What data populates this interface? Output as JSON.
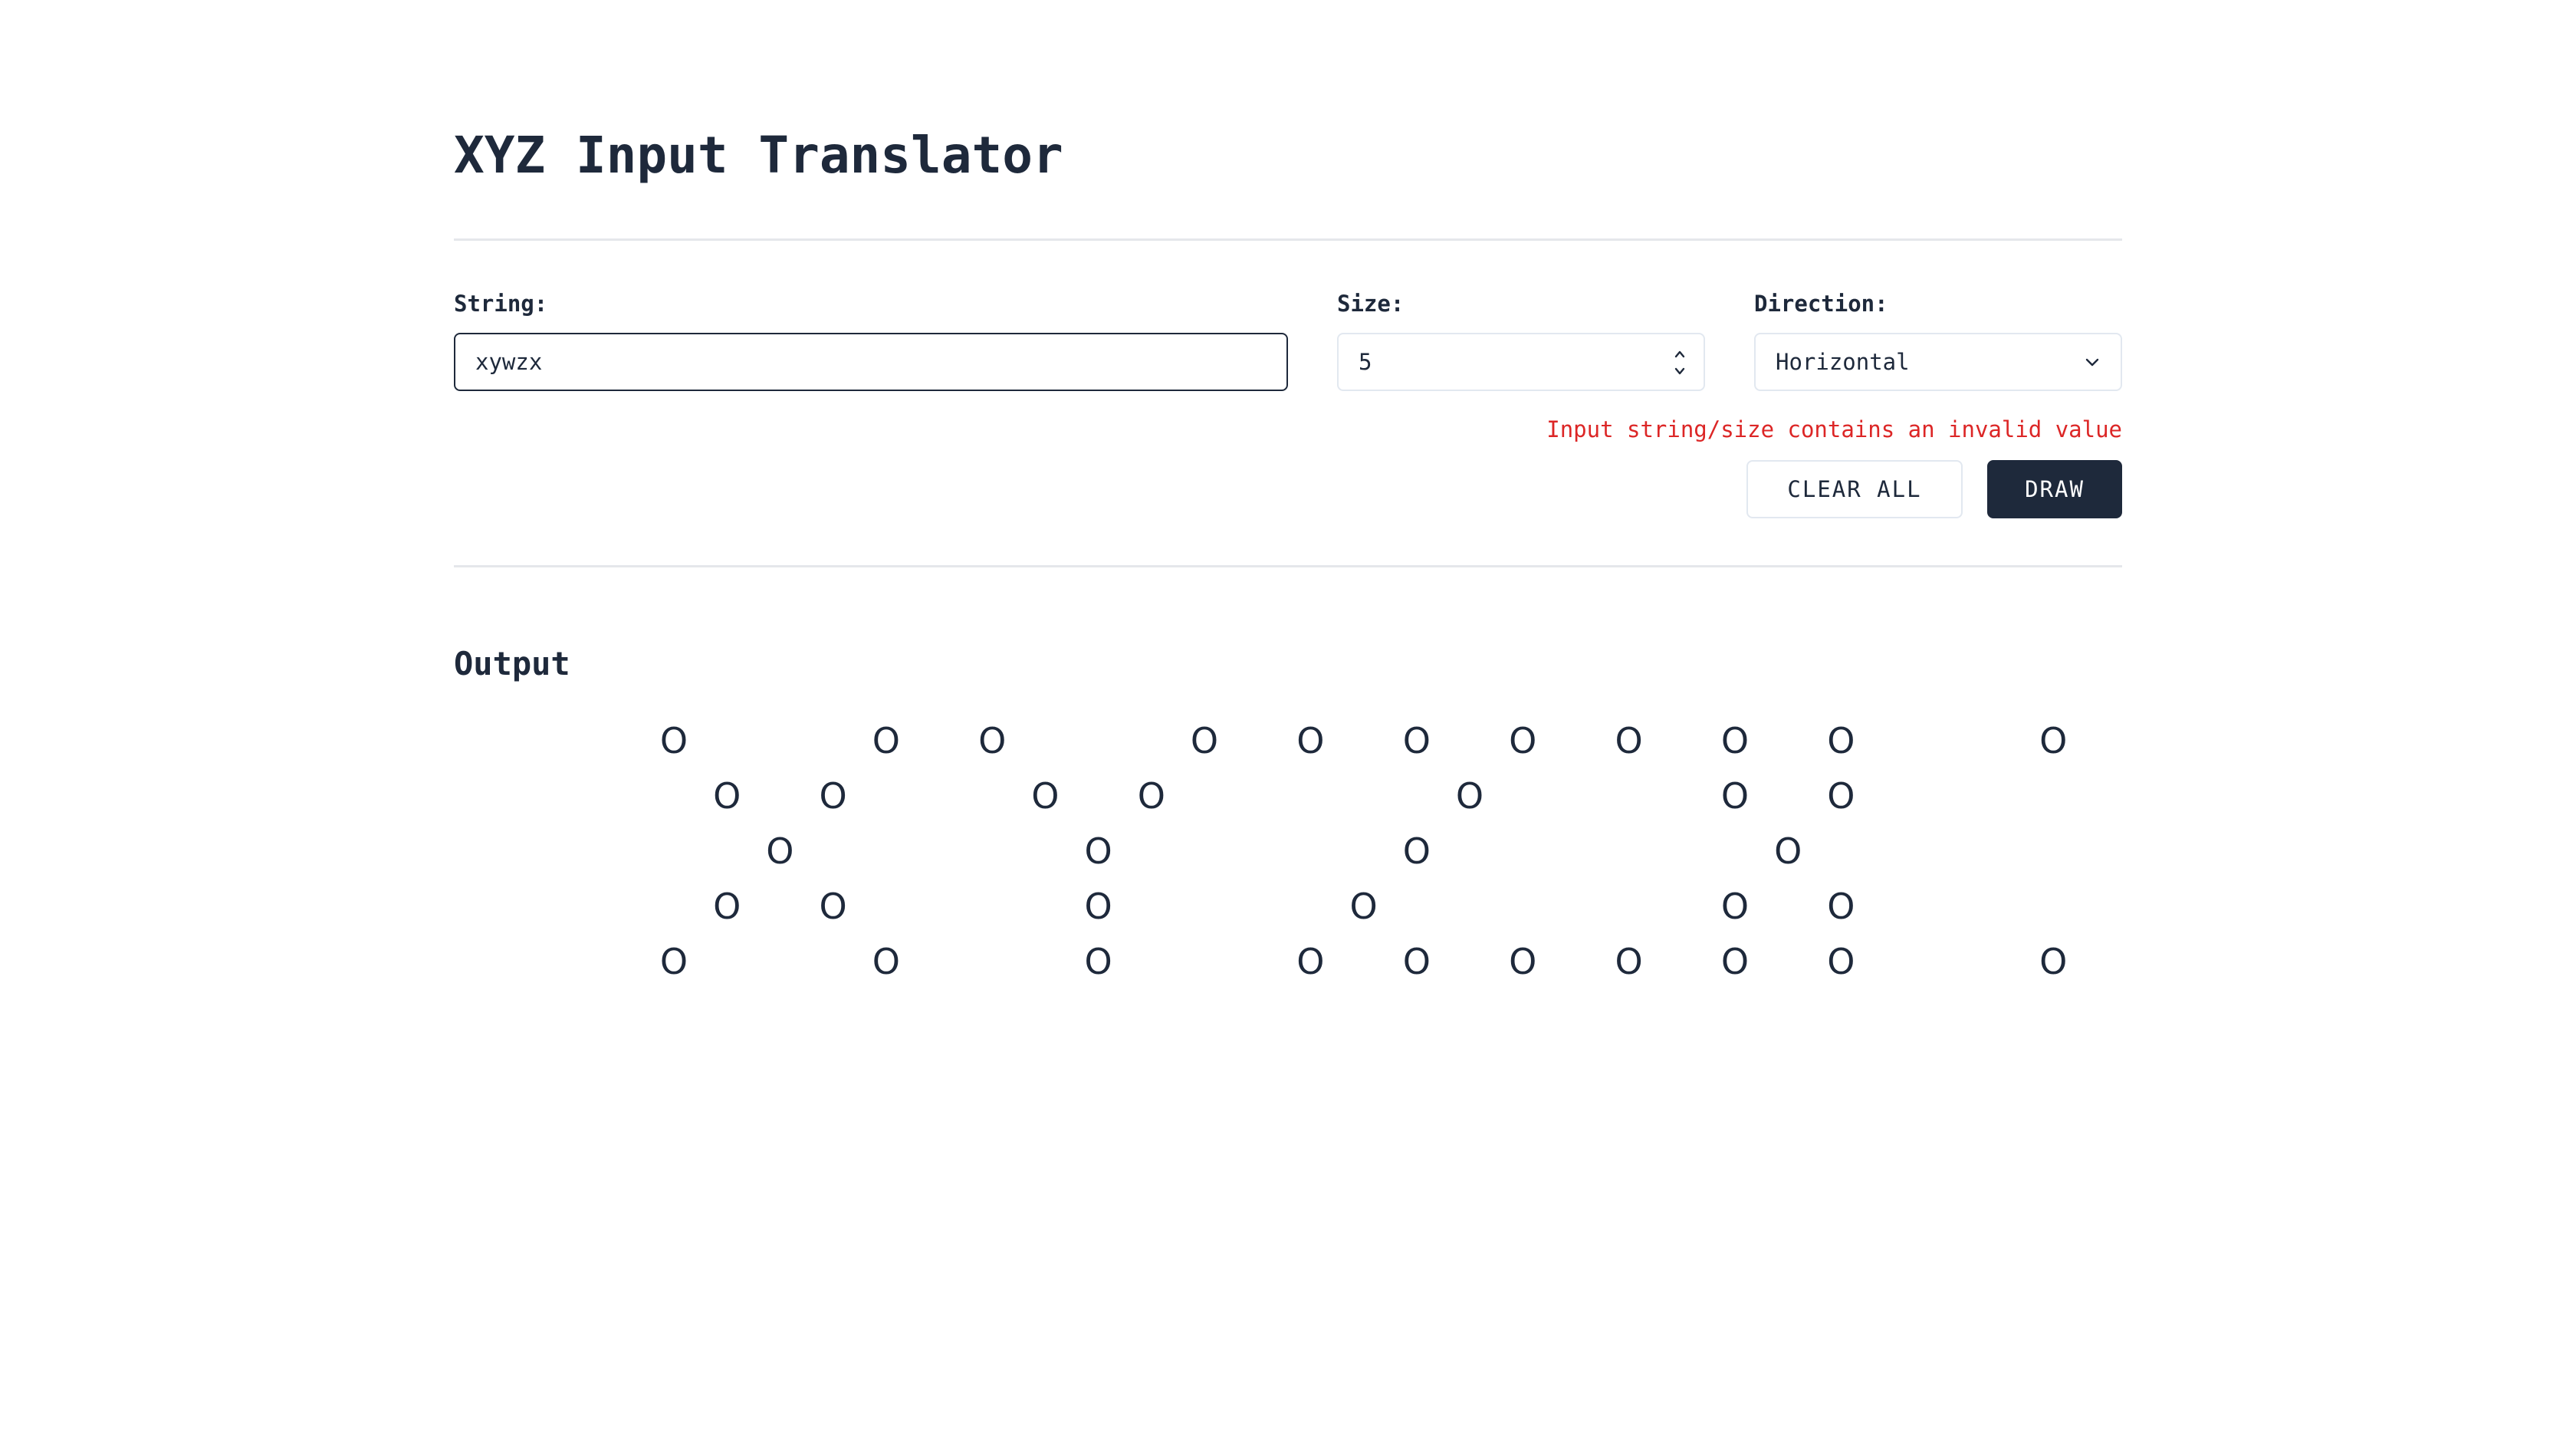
{
  "app": {
    "title": "XYZ Input Translator"
  },
  "form": {
    "string_label": "String:",
    "string_value": "xywzx",
    "size_label": "Size:",
    "size_value": "5",
    "direction_label": "Direction:",
    "direction_value": "Horizontal",
    "error_message": "Input string/size contains an invalid value"
  },
  "actions": {
    "clear_label": "CLEAR ALL",
    "draw_label": "DRAW"
  },
  "output": {
    "heading": "Output",
    "glyph": "O",
    "grid_rows": [
      "O   O O   O O O O O O O   O",
      " O O   O O     O    O O ",
      "  O     O     O      O  ",
      " O O    O    O      O O ",
      "O   O   O   O O O O O O   O"
    ]
  },
  "colors": {
    "text": "#1e293b",
    "error": "#dc2626",
    "primary_button": "#1e293b",
    "border": "#e2e8f0"
  },
  "icons": {
    "size_spinner": "up-down-arrows-icon",
    "direction_dropdown": "chevron-down-icon"
  }
}
